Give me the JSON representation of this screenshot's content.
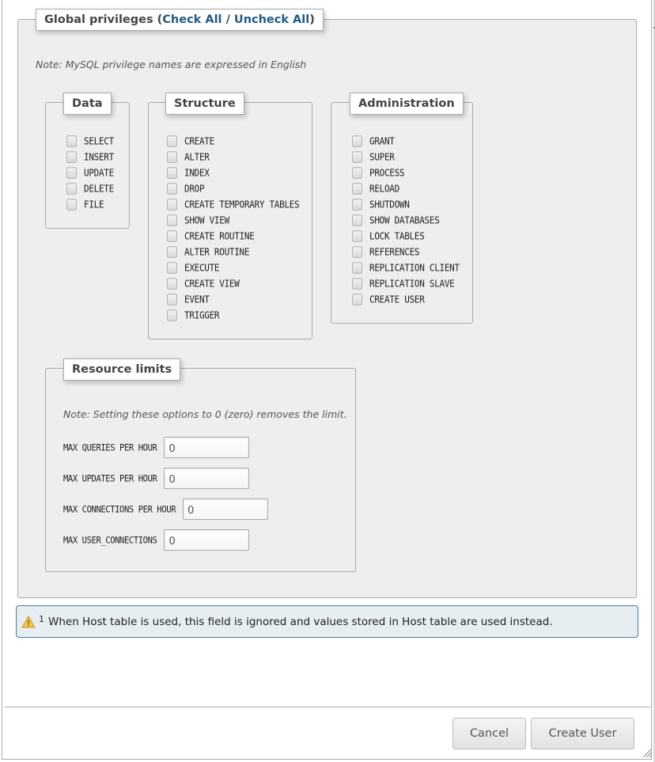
{
  "global_privileges": {
    "title": "Global privileges (",
    "check_all": "Check All",
    "separator": " / ",
    "uncheck_all": "Uncheck All",
    "close_paren": ")",
    "note": "Note: MySQL privilege names are expressed in English"
  },
  "groups": {
    "data": {
      "legend": "Data",
      "items": [
        "SELECT",
        "INSERT",
        "UPDATE",
        "DELETE",
        "FILE"
      ]
    },
    "structure": {
      "legend": "Structure",
      "items": [
        "CREATE",
        "ALTER",
        "INDEX",
        "DROP",
        "CREATE TEMPORARY TABLES",
        "SHOW VIEW",
        "CREATE ROUTINE",
        "ALTER ROUTINE",
        "EXECUTE",
        "CREATE VIEW",
        "EVENT",
        "TRIGGER"
      ]
    },
    "administration": {
      "legend": "Administration",
      "items": [
        "GRANT",
        "SUPER",
        "PROCESS",
        "RELOAD",
        "SHUTDOWN",
        "SHOW DATABASES",
        "LOCK TABLES",
        "REFERENCES",
        "REPLICATION CLIENT",
        "REPLICATION SLAVE",
        "CREATE USER"
      ]
    }
  },
  "resource_limits": {
    "legend": "Resource limits",
    "note": "Note: Setting these options to 0 (zero) removes the limit.",
    "fields": [
      {
        "label": "MAX QUERIES PER HOUR",
        "value": "0"
      },
      {
        "label": "MAX UPDATES PER HOUR",
        "value": "0"
      },
      {
        "label": "MAX CONNECTIONS PER HOUR",
        "value": "0"
      },
      {
        "label": "MAX USER_CONNECTIONS",
        "value": "0"
      }
    ]
  },
  "footnote": {
    "icon": "warning-icon",
    "marker": "1",
    "text": "When Host table is used, this field is ignored and values stored in Host table are used instead."
  },
  "buttons": {
    "cancel": "Cancel",
    "create_user": "Create User"
  },
  "colors": {
    "link": "#235a81",
    "fieldset_bg": "#eeeeee",
    "notice_bg": "#e7eef2",
    "notice_border": "#4e7a8f"
  }
}
